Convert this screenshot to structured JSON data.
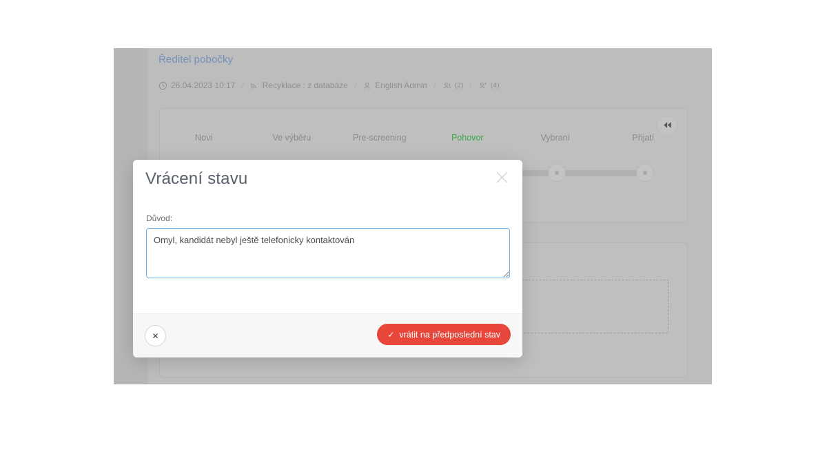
{
  "page": {
    "job_title": "Ředitel pobočky",
    "meta": [
      {
        "icon": "clock-icon",
        "label": "26.04.2023 10:17",
        "count": ""
      },
      {
        "icon": "broadcast-icon",
        "label": "Recyklace : z databáze",
        "count": ""
      },
      {
        "icon": "user-icon",
        "label": "English Admin",
        "count": ""
      },
      {
        "icon": "users-icon",
        "label": "",
        "count": "(2)"
      },
      {
        "icon": "users-add-icon",
        "label": "",
        "count": "(4)"
      }
    ],
    "separator": "/"
  },
  "stepper": {
    "steps": [
      {
        "label": "Noví",
        "active": false
      },
      {
        "label": "Ve výběru",
        "active": false
      },
      {
        "label": "Pre-screening",
        "active": false
      },
      {
        "label": "Pohovor",
        "active": true
      },
      {
        "label": "Vybraní",
        "active": false
      },
      {
        "label": "Přijatí",
        "active": false
      }
    ],
    "collapse_icon": "rewind-icon",
    "active_color": "#3aa84a"
  },
  "modal": {
    "title": "Vrácení stavu",
    "close_icon": "close-icon",
    "reason_label": "Důvod:",
    "reason_value": "Omyl, kandidát nebyl ještě telefonicky kontaktován",
    "reason_placeholder": "",
    "cancel_label": "✕",
    "cancel_icon": "close-icon",
    "confirm_label": "vrátit na předposlední stav",
    "confirm_icon": "check-icon",
    "confirm_color": "#e8463a"
  }
}
